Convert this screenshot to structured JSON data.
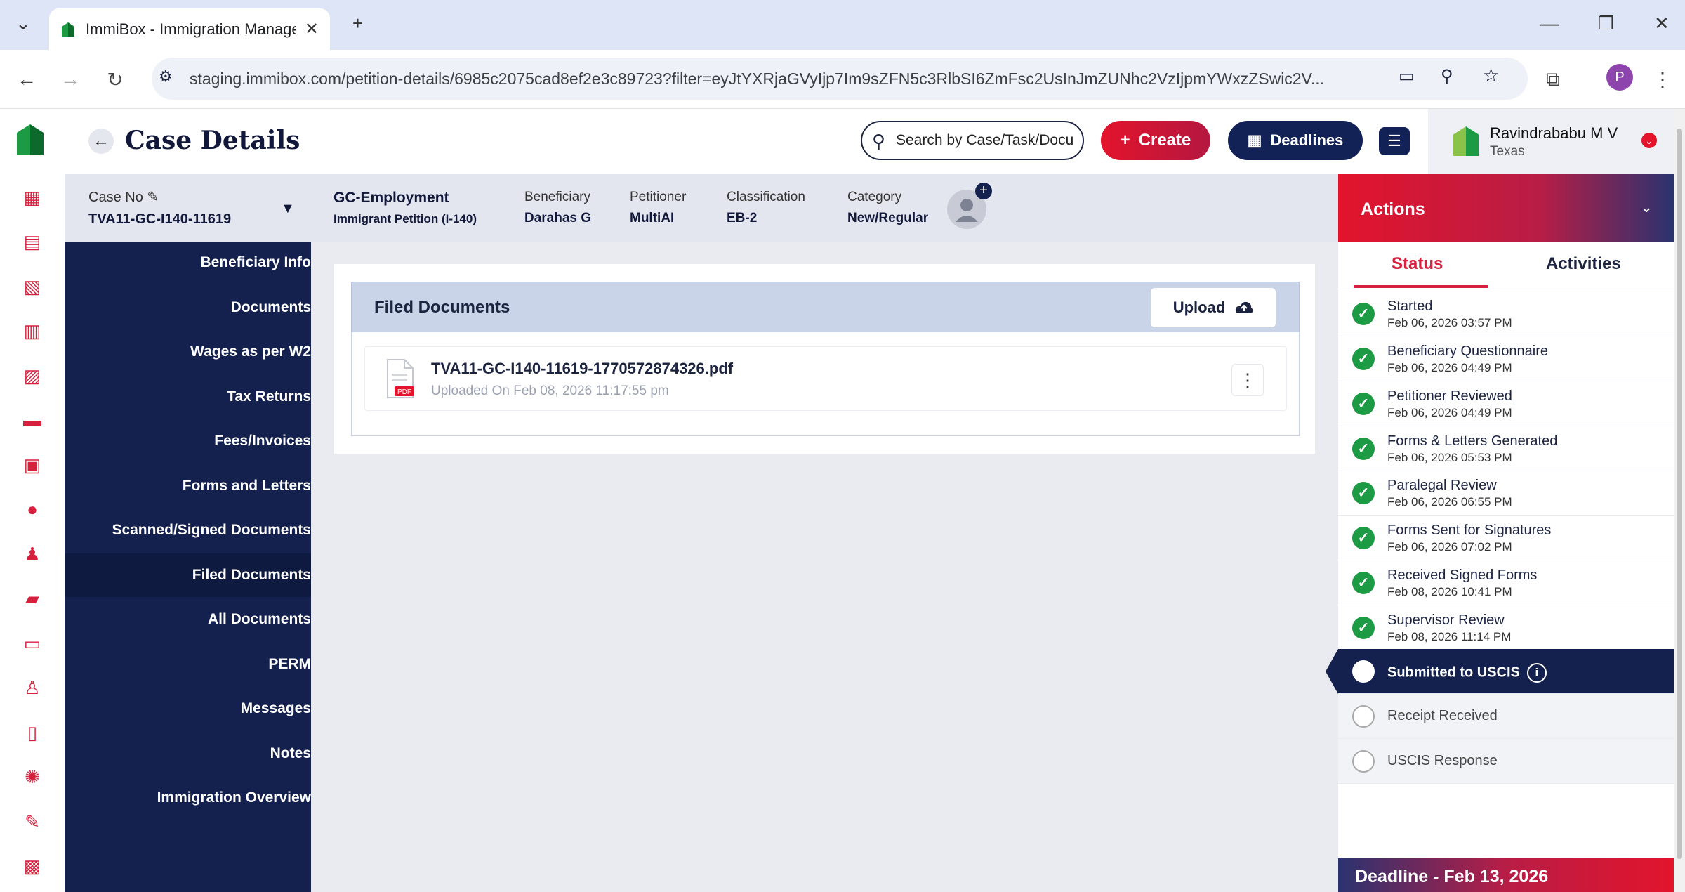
{
  "browser": {
    "tab_title": "ImmiBox - Immigration Manage",
    "url": "staging.immibox.com/petition-details/6985c2075cad8ef2e3c89723?filter=eyJtYXRjaGVyIjp7Im9sZFN5c3RlbSI6ZmFsc2UsInJmZUNhc2VzIjpmYWxzZSwic2V...",
    "profile_initial": "P"
  },
  "header": {
    "title": "Case Details",
    "search_placeholder": "Search by Case/Task/Docu",
    "create_label": "Create",
    "deadlines_label": "Deadlines",
    "user_name": "Ravindrababu M V",
    "user_location": "Texas"
  },
  "case": {
    "case_no_label": "Case No",
    "case_no": "TVA11-GC-I140-11619",
    "type": "GC-Employment",
    "type_sub": "Immigrant Petition (I-140)",
    "beneficiary_label": "Beneficiary",
    "beneficiary": "Darahas G",
    "petitioner_label": "Petitioner",
    "petitioner": "MultiAI",
    "classification_label": "Classification",
    "classification": "EB-2",
    "category_label": "Category",
    "category": "New/Regular"
  },
  "nav": {
    "items": [
      "Beneficiary Info",
      "Documents",
      "Wages as per W2",
      "Tax Returns",
      "Fees/Invoices",
      "Forms and Letters",
      "Scanned/Signed Documents",
      "Filed Documents",
      "All Documents",
      "PERM",
      "Messages",
      "Notes",
      "Immigration Overview"
    ],
    "active": "Filed Documents"
  },
  "filed": {
    "title": "Filed Documents",
    "upload_label": "Upload",
    "file_name": "TVA11-GC-I140-11619-1770572874326.pdf",
    "file_meta": "Uploaded On Feb 08, 2026 11:17:55 pm",
    "file_badge": "PDF"
  },
  "actions": {
    "title": "Actions",
    "tab_status": "Status",
    "tab_activities": "Activities",
    "steps": [
      {
        "name": "Started",
        "date": "Feb 06, 2026 03:57 PM"
      },
      {
        "name": "Beneficiary Questionnaire",
        "date": "Feb 06, 2026 04:49 PM"
      },
      {
        "name": "Petitioner Reviewed",
        "date": "Feb 06, 2026 04:49 PM"
      },
      {
        "name": "Forms & Letters Generated",
        "date": "Feb 06, 2026 05:53 PM"
      },
      {
        "name": "Paralegal Review",
        "date": "Feb 06, 2026 06:55 PM"
      },
      {
        "name": "Forms Sent for Signatures",
        "date": "Feb 06, 2026 07:02 PM"
      },
      {
        "name": "Received Signed Forms",
        "date": "Feb 08, 2026 10:41 PM"
      },
      {
        "name": "Supervisor Review",
        "date": "Feb 08, 2026 11:14 PM"
      }
    ],
    "current": "Submitted to USCIS",
    "pending": [
      "Receipt Received",
      "USCIS Response"
    ],
    "deadline": "Deadline - Feb 13, 2026"
  },
  "colors": {
    "brand_red": "#e3142c",
    "navy": "#14214e",
    "success_green": "#1d9a44"
  }
}
